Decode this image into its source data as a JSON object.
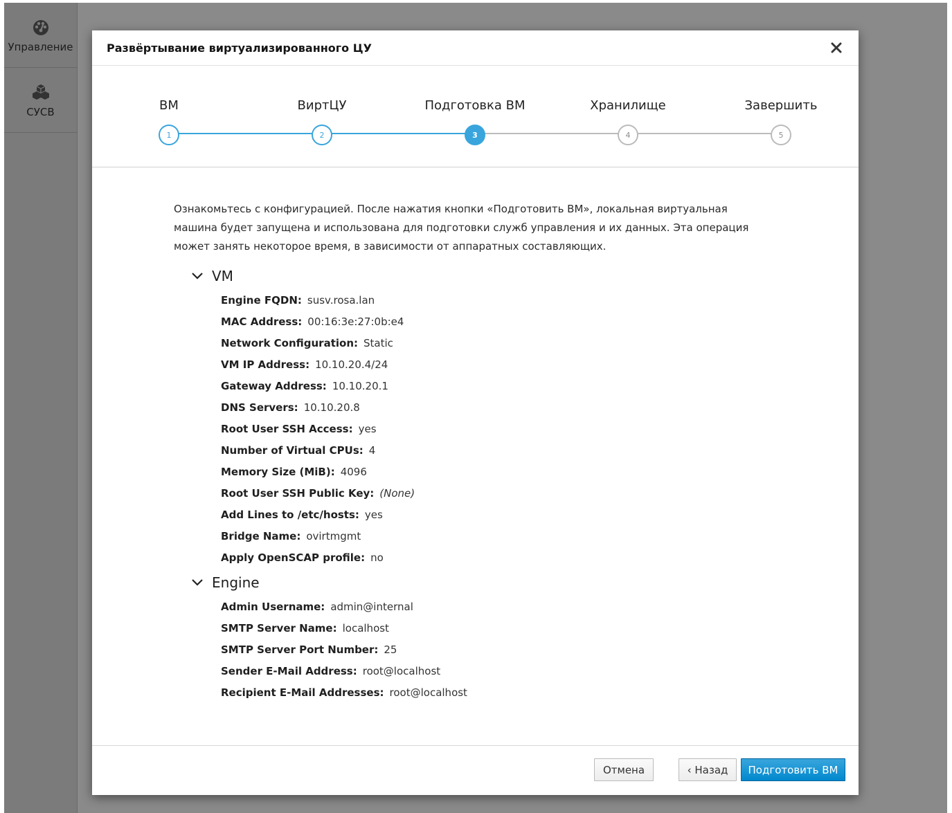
{
  "sidebar": {
    "items": [
      {
        "label": "Управление",
        "icon": "dashboard-icon"
      },
      {
        "label": "СУСВ",
        "icon": "cubes-icon"
      }
    ]
  },
  "dialog": {
    "title": "Развёртывание виртуализированного ЦУ",
    "close_icon": "close-icon"
  },
  "wizard": {
    "steps": [
      {
        "label": "ВМ",
        "number": "1",
        "state": "done"
      },
      {
        "label": "ВиртЦУ",
        "number": "2",
        "state": "done"
      },
      {
        "label": "Подготовка ВМ",
        "number": "3",
        "state": "active"
      },
      {
        "label": "Хранилище",
        "number": "4",
        "state": "todo"
      },
      {
        "label": "Завершить",
        "number": "5",
        "state": "todo"
      }
    ]
  },
  "body": {
    "intro": "Ознакомьтесь с конфигурацией. После нажатия кнопки «Подготовить ВМ», локальная виртуальная машина будет запущена и использована для подготовки служб управления и их данных. Эта операция может занять некоторое время, в зависимости от аппаратных составляющих.",
    "sections": [
      {
        "title": "VM",
        "fields": [
          {
            "label": "Engine FQDN:",
            "value": "susv.rosa.lan"
          },
          {
            "label": "MAC Address:",
            "value": "00:16:3e:27:0b:e4"
          },
          {
            "label": "Network Configuration:",
            "value": "Static"
          },
          {
            "label": "VM IP Address:",
            "value": "10.10.20.4/24"
          },
          {
            "label": "Gateway Address:",
            "value": "10.10.20.1"
          },
          {
            "label": "DNS Servers:",
            "value": "10.10.20.8"
          },
          {
            "label": "Root User SSH Access:",
            "value": "yes"
          },
          {
            "label": "Number of Virtual CPUs:",
            "value": "4"
          },
          {
            "label": "Memory Size (MiB):",
            "value": "4096"
          },
          {
            "label": "Root User SSH Public Key:",
            "value": "(None)",
            "italic": true
          },
          {
            "label": "Add Lines to /etc/hosts:",
            "value": "yes"
          },
          {
            "label": "Bridge Name:",
            "value": "ovirtmgmt"
          },
          {
            "label": "Apply OpenSCAP profile:",
            "value": "no"
          }
        ]
      },
      {
        "title": "Engine",
        "fields": [
          {
            "label": "Admin Username:",
            "value": "admin@internal"
          },
          {
            "label": "SMTP Server Name:",
            "value": "localhost"
          },
          {
            "label": "SMTP Server Port Number:",
            "value": "25"
          },
          {
            "label": "Sender E-Mail Address:",
            "value": "root@localhost"
          },
          {
            "label": "Recipient E-Mail Addresses:",
            "value": "root@localhost"
          }
        ]
      }
    ]
  },
  "footer": {
    "cancel_label": "Отмена",
    "back_label": "‹ Назад",
    "next_label": "Подготовить ВМ"
  },
  "colors": {
    "accent": "#39a5dc",
    "primary_button": "#0088ce"
  }
}
